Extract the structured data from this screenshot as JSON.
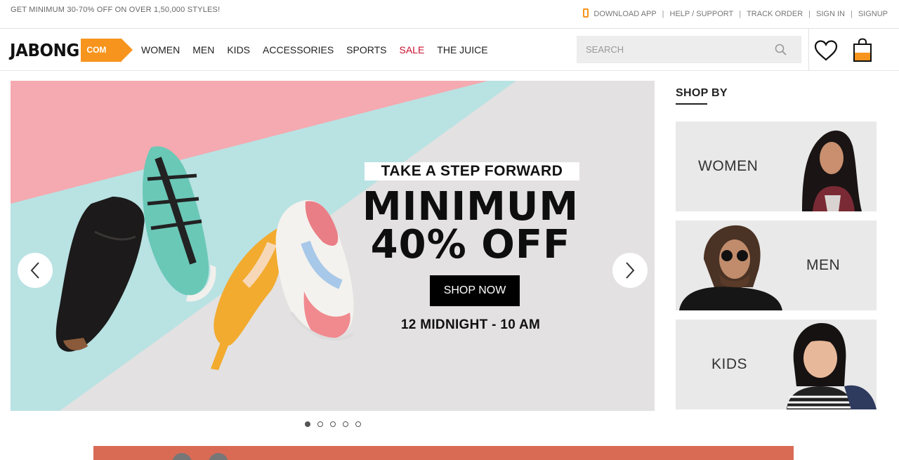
{
  "topbar": {
    "promo": "GET MINIMUM 30-70% OFF ON OVER 1,50,000 STYLES!",
    "links": [
      "DOWNLOAD APP",
      "HELP / SUPPORT",
      "TRACK ORDER",
      "SIGN IN",
      "SIGNUP"
    ],
    "separator": "|"
  },
  "header": {
    "logo_text": "JABONG",
    "logo_suffix": "COM",
    "nav": [
      "WOMEN",
      "MEN",
      "KIDS",
      "ACCESSORIES",
      "SPORTS",
      "SALE",
      "THE JUICE"
    ],
    "search_placeholder": "SEARCH",
    "accent_color": "#f7941d",
    "sale_color": "#c8102e"
  },
  "banner": {
    "tagline": "TAKE A STEP FORWARD",
    "headline_line1": "MINIMUM",
    "headline_line2": "40% OFF",
    "cta": "SHOP NOW",
    "time": "12 MIDNIGHT - 10 AM",
    "slides_total": 5,
    "active_slide": 1
  },
  "shop_by": {
    "title": "SHOP BY",
    "tiles": [
      "WOMEN",
      "MEN",
      "KIDS"
    ]
  }
}
